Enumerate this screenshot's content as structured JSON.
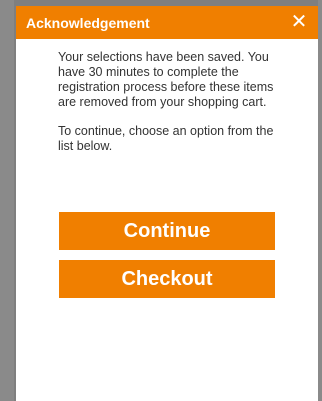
{
  "dialog": {
    "title": "Acknowledgement",
    "close_symbol": "✕",
    "message_1": "Your selections have been saved. You have 30 minutes to complete the registration process before these items are removed from your shopping cart.",
    "message_2": "To continue, choose an option from the list below.",
    "continue_label": "Continue",
    "checkout_label": "Checkout"
  },
  "icons": {
    "close": "close-icon"
  },
  "colors": {
    "accent": "#f07f00",
    "overlay": "#7f7f7f",
    "text": "#333333"
  }
}
